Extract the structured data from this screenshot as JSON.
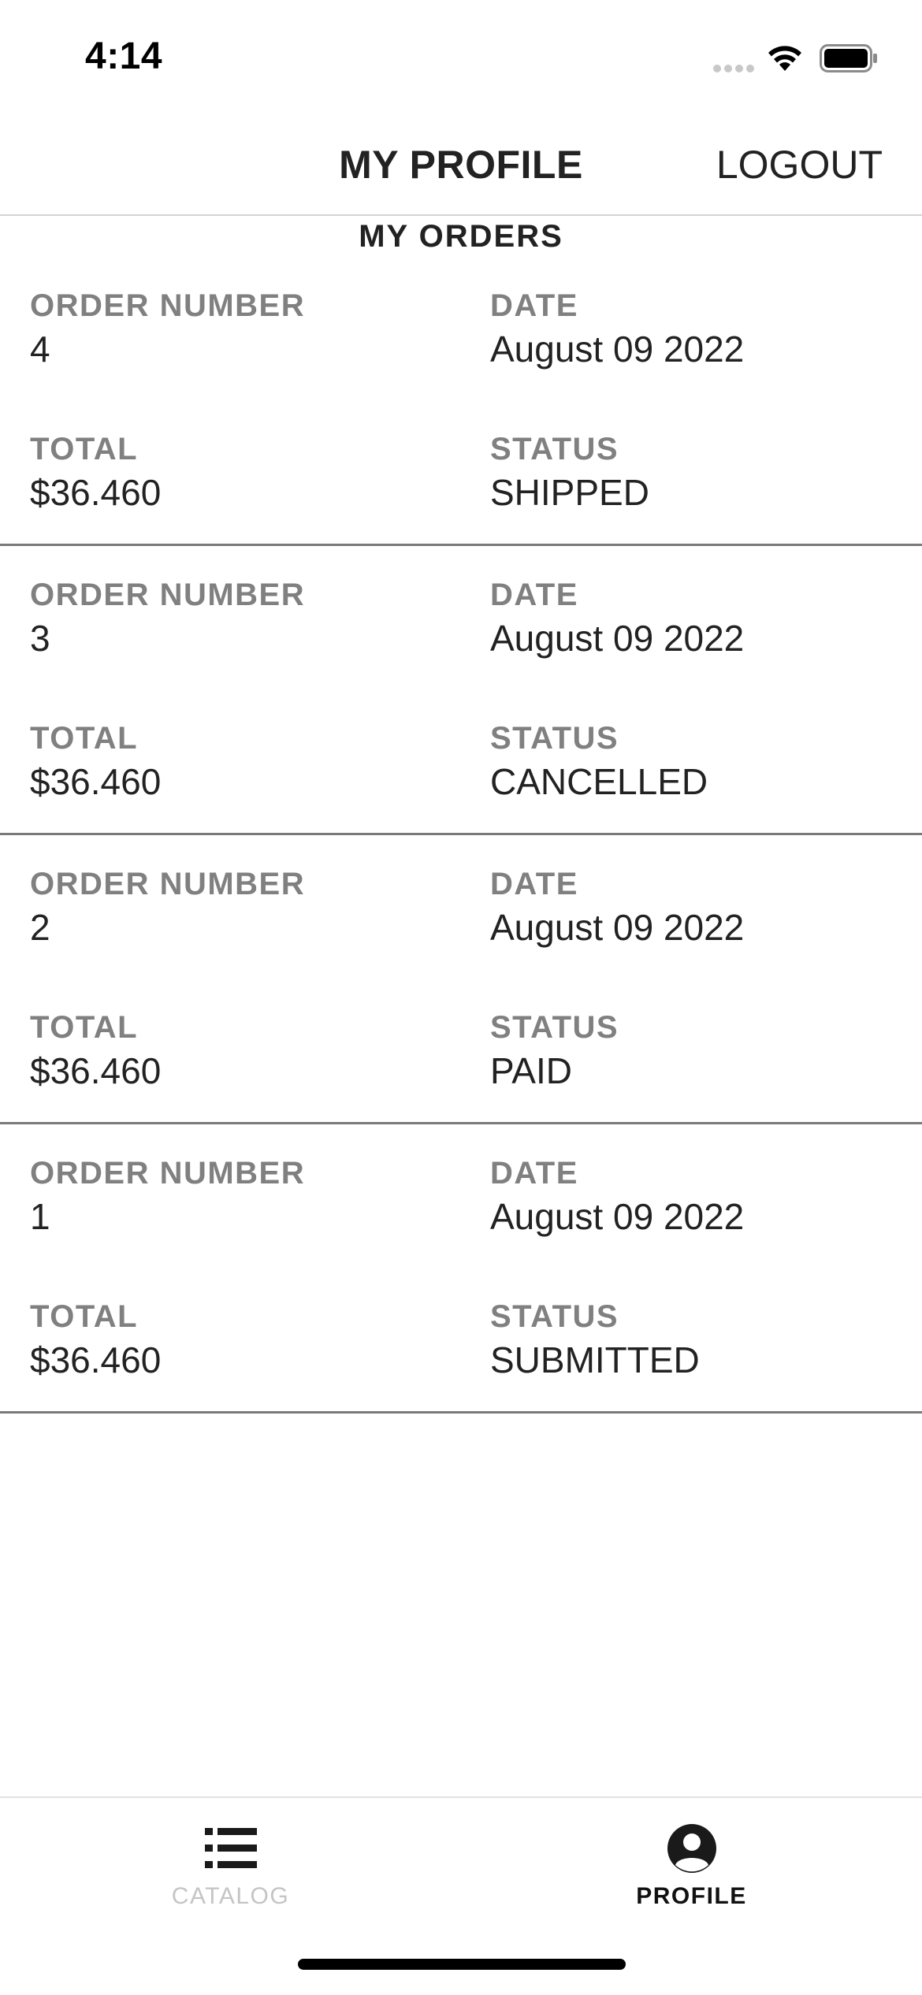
{
  "status_bar": {
    "time": "4:14"
  },
  "header": {
    "title": "MY PROFILE",
    "logout_label": "LOGOUT"
  },
  "section_title": "MY ORDERS",
  "labels": {
    "order_number": "ORDER NUMBER",
    "date": "DATE",
    "total": "TOTAL",
    "status": "STATUS"
  },
  "orders": [
    {
      "number": "4",
      "date": "August 09 2022",
      "total": "$36.460",
      "status": "SHIPPED"
    },
    {
      "number": "3",
      "date": "August 09 2022",
      "total": "$36.460",
      "status": "CANCELLED"
    },
    {
      "number": "2",
      "date": "August 09 2022",
      "total": "$36.460",
      "status": "PAID"
    },
    {
      "number": "1",
      "date": "August 09 2022",
      "total": "$36.460",
      "status": "SUBMITTED"
    }
  ],
  "tab_bar": {
    "tabs": [
      {
        "label": "CATALOG",
        "icon": "list-icon",
        "active": false
      },
      {
        "label": "PROFILE",
        "icon": "user-circle-icon",
        "active": true
      }
    ]
  },
  "colors": {
    "label_gray": "#808080",
    "text_dark": "#222222",
    "divider": "#7a7a7a",
    "tab_inactive": "#c4c4c4",
    "tab_active": "#111111"
  }
}
